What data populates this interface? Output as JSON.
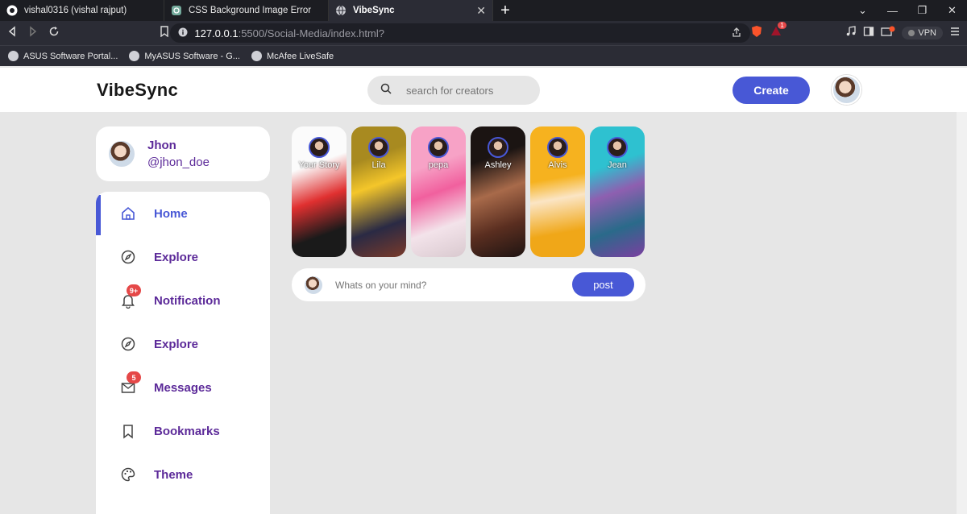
{
  "browser": {
    "tabs": [
      {
        "label": "vishal0316 (vishal rajput)",
        "icon": "github-icon"
      },
      {
        "label": "CSS Background Image Error",
        "icon": "chatgpt-icon"
      },
      {
        "label": "VibeSync",
        "icon": "globe-icon",
        "active": true
      }
    ],
    "url_host": "127.0.0.1",
    "url_path": ":5500/Social-Media/index.html?",
    "vpn_label": "VPN",
    "brave_badge": "1",
    "bookmarks": [
      "ASUS Software Portal...",
      "MyASUS Software - G...",
      "McAfee LiveSafe"
    ]
  },
  "app": {
    "logo": "VibeSync",
    "search_placeholder": "search for creators",
    "create_label": "Create"
  },
  "profile": {
    "name": "Jhon",
    "handle": "@jhon_doe"
  },
  "menu": [
    {
      "label": "Home",
      "icon": "home-icon",
      "active": true
    },
    {
      "label": "Explore",
      "icon": "compass-icon"
    },
    {
      "label": "Notification",
      "icon": "bell-icon",
      "badge": "9+"
    },
    {
      "label": "Explore",
      "icon": "compass-icon"
    },
    {
      "label": "Messages",
      "icon": "mail-icon",
      "badge": "5"
    },
    {
      "label": "Bookmarks",
      "icon": "bookmark-icon"
    },
    {
      "label": "Theme",
      "icon": "palette-icon"
    }
  ],
  "stories": [
    {
      "name": "Your Story"
    },
    {
      "name": "Lila"
    },
    {
      "name": "pepa"
    },
    {
      "name": "Ashley"
    },
    {
      "name": "Alvis"
    },
    {
      "name": "Jean"
    }
  ],
  "post": {
    "placeholder": "Whats on your mind?",
    "button": "post"
  },
  "colors": {
    "accent": "#4858d6",
    "text_purple": "#5c2a99",
    "badge_red": "#e54848"
  }
}
